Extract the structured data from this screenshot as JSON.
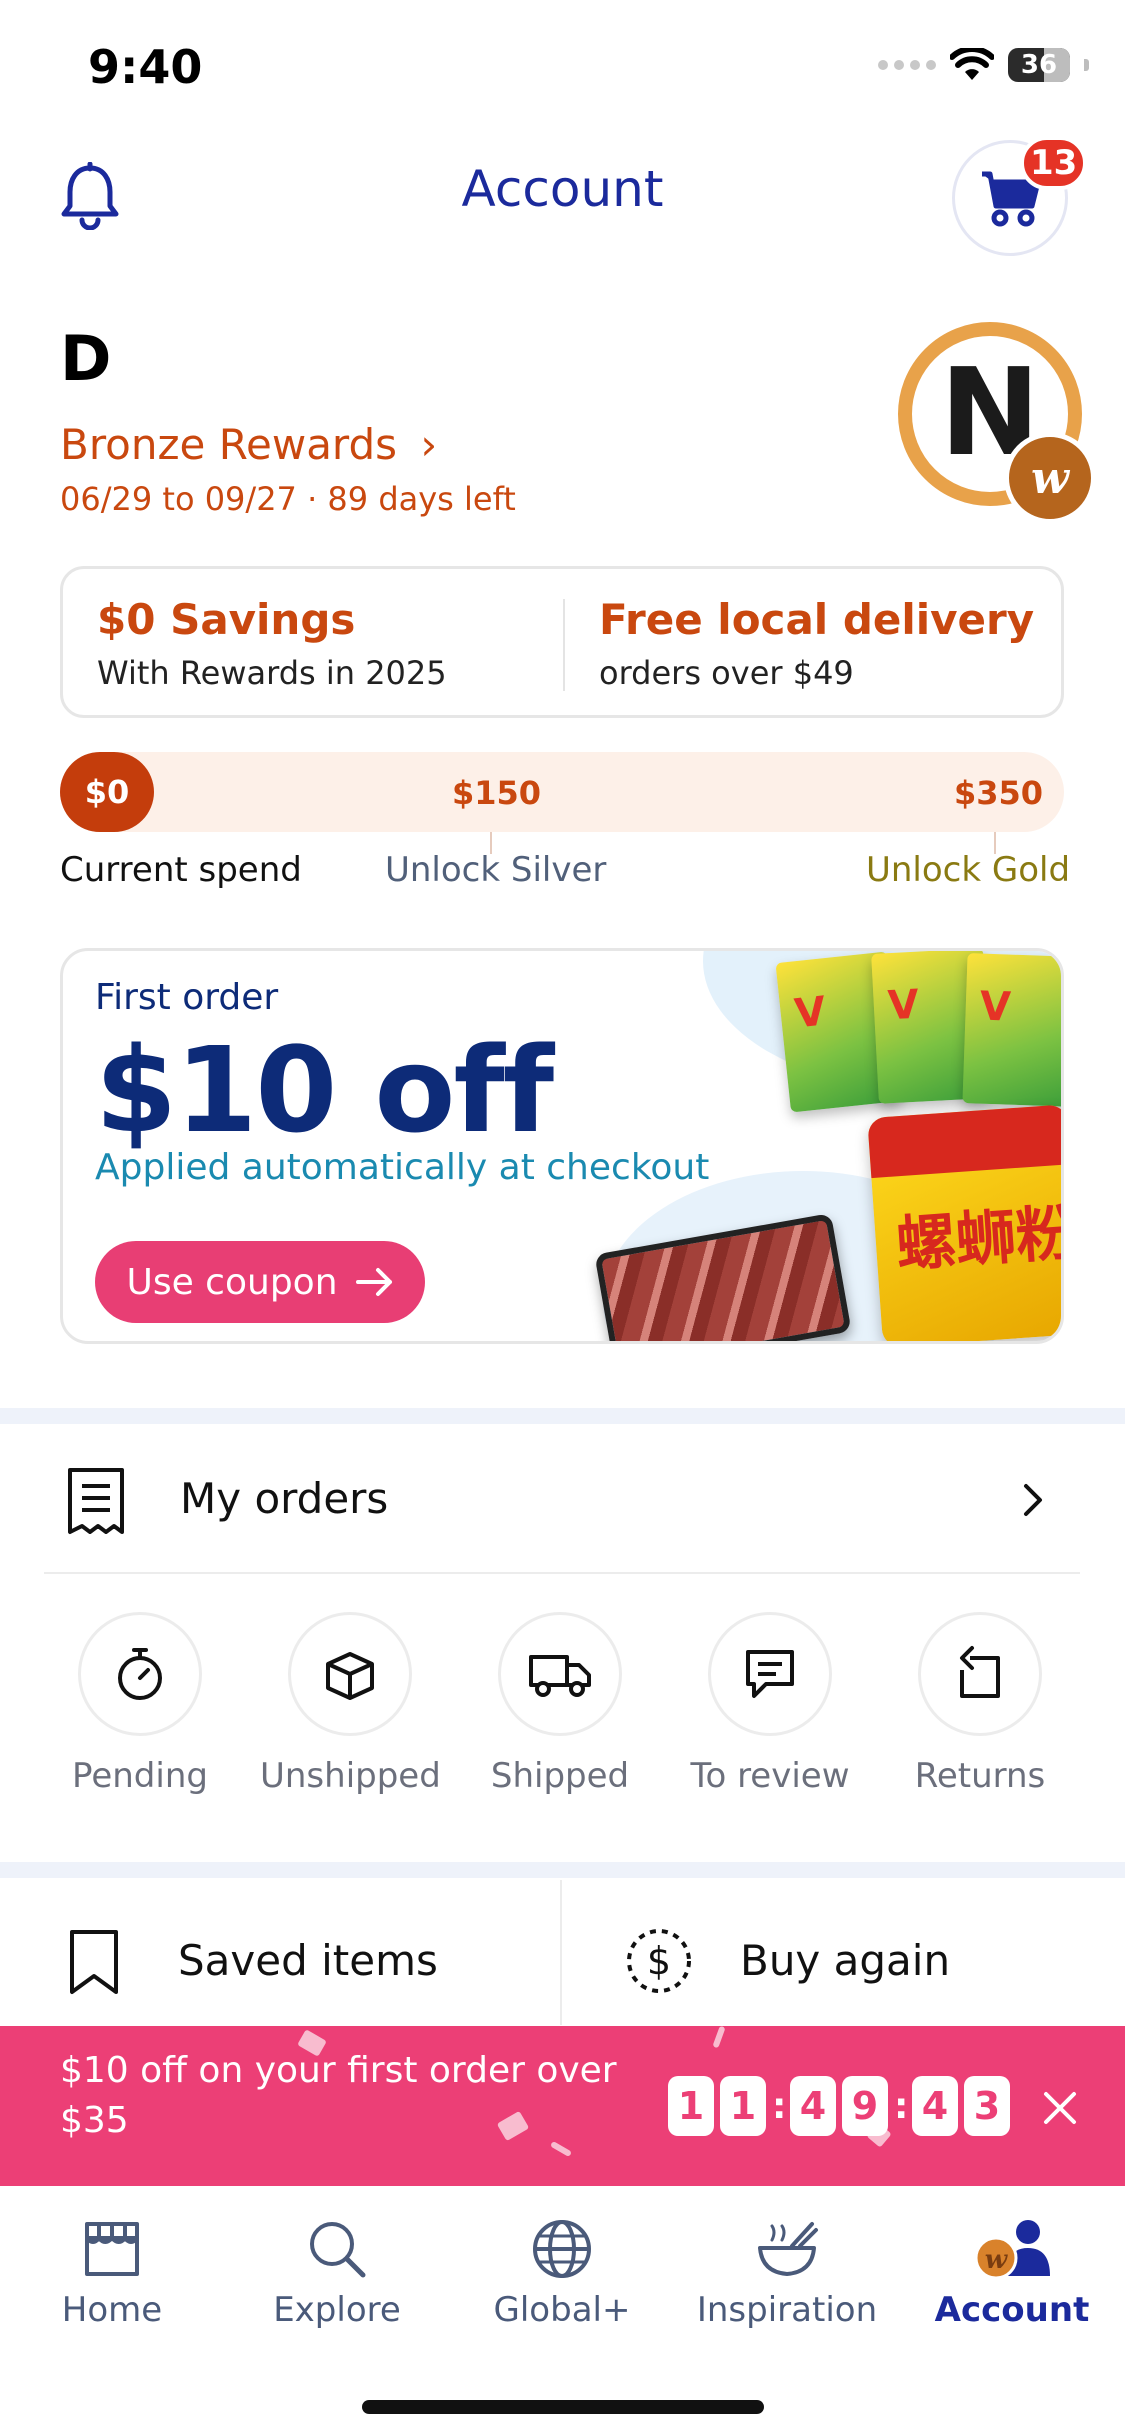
{
  "status_bar": {
    "time": "9:40",
    "battery": "36"
  },
  "header": {
    "title": "Account",
    "cart_count": "13"
  },
  "user": {
    "initial": "D",
    "tier": "Bronze Rewards",
    "period": "06/29 to 09/27 · 89 days left",
    "avatar_letter": "N",
    "avatar_badge": "w"
  },
  "benefits": [
    {
      "title": "$0 Savings",
      "subtitle": "With Rewards in 2025"
    },
    {
      "title": "Free local delivery",
      "subtitle": "orders over $49"
    }
  ],
  "progress": {
    "current_amount": "$0",
    "current_label": "Current spend",
    "milestones": [
      {
        "amount": "$150",
        "label": "Unlock Silver",
        "color": "#51607a"
      },
      {
        "amount": "$350",
        "label": "Unlock Gold",
        "color": "#8a7a12"
      }
    ]
  },
  "coupon": {
    "kicker": "First order",
    "amount": "$10 off",
    "note": "Applied automatically at checkout",
    "button": "Use coupon"
  },
  "orders": {
    "title": "My orders",
    "statuses": [
      {
        "label": "Pending",
        "icon": "stopwatch-icon"
      },
      {
        "label": "Unshipped",
        "icon": "box-icon"
      },
      {
        "label": "Shipped",
        "icon": "truck-icon"
      },
      {
        "label": "To review",
        "icon": "chat-icon"
      },
      {
        "label": "Returns",
        "icon": "return-icon"
      }
    ]
  },
  "shortcuts": {
    "saved": "Saved items",
    "buy_again": "Buy again"
  },
  "promo": {
    "text": "$10 off on your first order over $35",
    "countdown": [
      "1",
      "1",
      "4",
      "9",
      "4",
      "3"
    ]
  },
  "tabs": [
    {
      "label": "Home",
      "icon": "store-icon"
    },
    {
      "label": "Explore",
      "icon": "search-icon"
    },
    {
      "label": "Global+",
      "icon": "globe-icon"
    },
    {
      "label": "Inspiration",
      "icon": "bowl-icon"
    },
    {
      "label": "Account",
      "icon": "account-icon",
      "active": true
    }
  ],
  "colors": {
    "brand_blue": "#1b2a9c",
    "rewards_orange": "#c9480f",
    "promo_pink": "#ec3f76",
    "badge_red": "#e53326"
  }
}
